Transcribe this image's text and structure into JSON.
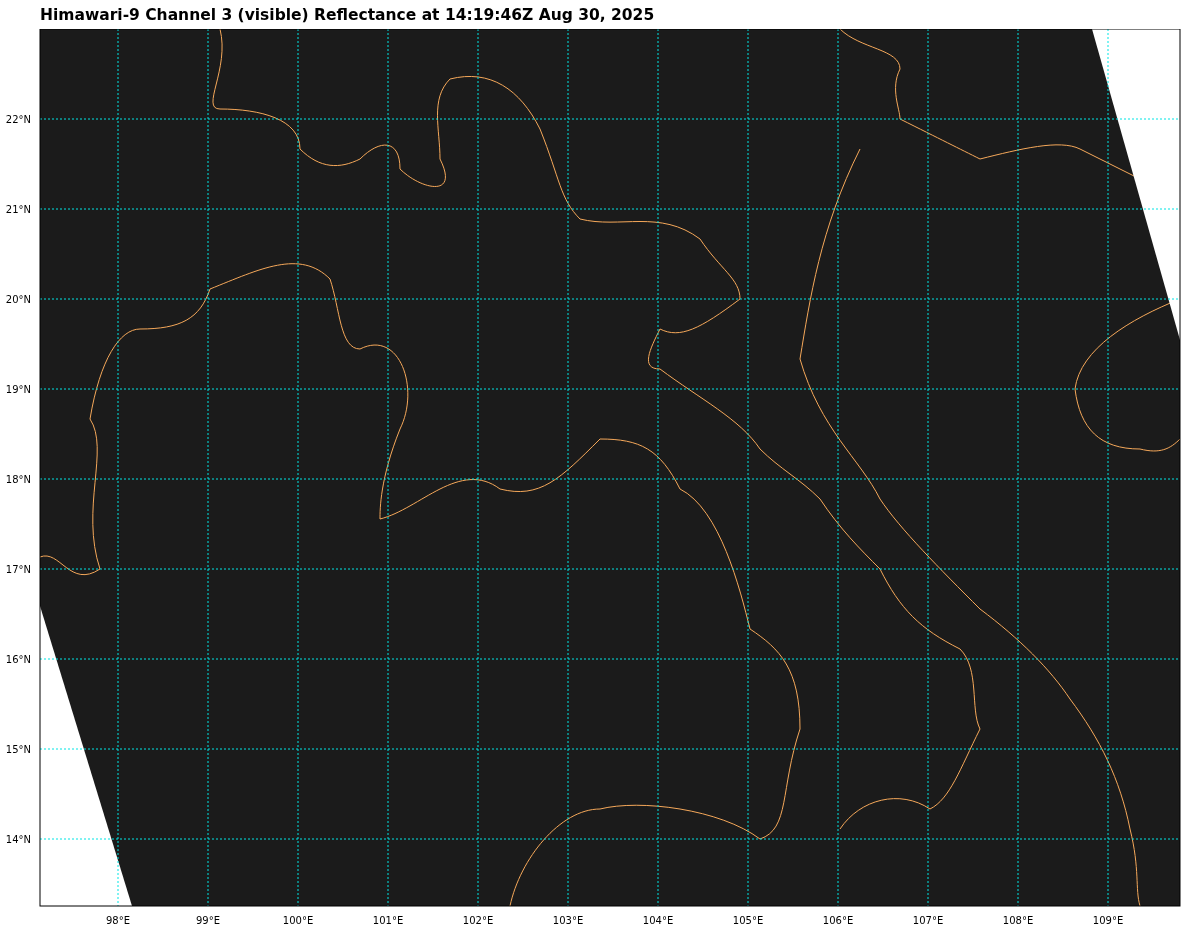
{
  "title": "Himawari-9 Channel 3 (visible) Reflectance at 14:19:46Z Aug 30, 2025",
  "map": {
    "lat_labels": [
      "22°N",
      "21°N",
      "20°N",
      "19°N",
      "18°N",
      "17°N",
      "16°N",
      "15°N",
      "14°N"
    ],
    "lon_labels": [
      "98°E",
      "99°E",
      "100°E",
      "101°E",
      "102°E",
      "103°E",
      "104°E",
      "105°E",
      "106°E",
      "107°E",
      "108°E",
      "109°E"
    ]
  }
}
